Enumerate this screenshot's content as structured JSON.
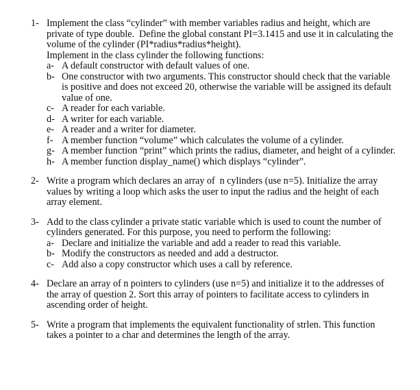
{
  "document": {
    "questions": [
      {
        "marker": "1-",
        "text": "Implement the class “cylinder” with member variables radius and height, which are private of type double.  Define the global constant PI=3.1415 and use it in calculating the volume of the cylinder (PI*radius*radius*height).\nImplement in the class cylinder the following functions:",
        "subitems": [
          {
            "marker": "a-",
            "text": "A default constructor with default values of one."
          },
          {
            "marker": "b-",
            "text": "One constructor with two arguments. This constructor should check that the variable is positive and does not exceed 20, otherwise the variable will be assigned its default value of one."
          },
          {
            "marker": "c-",
            "text": "A reader for each variable."
          },
          {
            "marker": "d-",
            "text": "A writer for each variable."
          },
          {
            "marker": "e-",
            "text": "A reader and a writer for diameter."
          },
          {
            "marker": "f-",
            "text": "A member function “volume” which calculates the volume of a cylinder."
          },
          {
            "marker": "g-",
            "text": "A member function “print” which prints the radius, diameter, and height of a cylinder."
          },
          {
            "marker": "h-",
            "text": "A member function display_name() which displays “cylinder”."
          }
        ]
      },
      {
        "marker": "2-",
        "text": "Write a program which declares an array of  n cylinders (use n=5). Initialize the array values by writing a loop which asks the user to input the radius and the height of each array element.",
        "subitems": []
      },
      {
        "marker": "3-",
        "text": "Add to the class cylinder a private static variable which is used to count the number of cylinders generated. For this purpose, you need to perform the following:",
        "subitems": [
          {
            "marker": "a-",
            "text": "Declare and initialize the variable and add a reader to read this variable."
          },
          {
            "marker": "b-",
            "text": "Modify the constructors as needed and add a destructor."
          },
          {
            "marker": "c-",
            "text": "Add also a copy constructor which uses a call by reference."
          }
        ]
      },
      {
        "marker": "4-",
        "text": "Declare an array of n pointers to cylinders (use n=5) and initialize it to the addresses of the array of question 2. Sort this array of pointers to facilitate access to cylinders in ascending order of height.",
        "subitems": []
      },
      {
        "marker": "5-",
        "text": "Write a program that implements the equivalent functionality of strlen. This function takes a pointer to a char and determines the length of the array.",
        "subitems": []
      }
    ]
  }
}
